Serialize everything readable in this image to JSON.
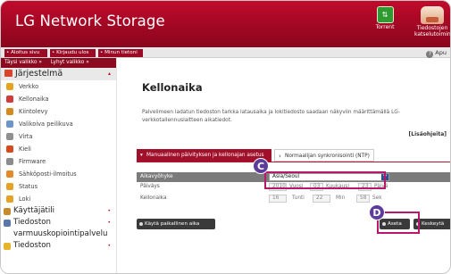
{
  "header": {
    "title": "LG Network Storage",
    "torrent_label": "Torrent",
    "file_service_label_1": "Tiedostojen",
    "file_service_label_2": "katselutoiminta"
  },
  "toolbar": {
    "home": "• Aloitus sivu",
    "logout": "• Kirjaudu ulos",
    "my_data": "• Minun tietoni",
    "help": "Apu"
  },
  "sidebar": {
    "full_menu": "Täysi valikko »",
    "short_menu": "Lyhyt valikko »",
    "category": "Järjestelmä",
    "items": [
      {
        "label": "Verkko",
        "color": "#e4a51d"
      },
      {
        "label": "Kellonaika",
        "color": "#d23b3b"
      },
      {
        "label": "Kiintolevy",
        "color": "#d48b1e"
      },
      {
        "label": "Valikoiva peilikuva",
        "color": "#6d95c9"
      },
      {
        "label": "Virta",
        "color": "#8f8f8f"
      },
      {
        "label": "Kieli",
        "color": "#d64a1d"
      },
      {
        "label": "Firmware",
        "color": "#8c8c8c"
      },
      {
        "label": "Sähköposti-ilmoitus",
        "color": "#e58a2a"
      },
      {
        "label": "Status",
        "color": "#e5a326"
      },
      {
        "label": "Loki",
        "color": "#e5a326"
      }
    ],
    "sub_categories": [
      {
        "label": "Käyttäjätili",
        "color": "#c78a2e"
      },
      {
        "label": "Tiedoston",
        "color": "#5a77a8"
      },
      {
        "label": "varmuuskopiointipalvelu",
        "color": ""
      },
      {
        "label": "Tiedoston",
        "color": "#e5b42a"
      }
    ]
  },
  "main": {
    "title": "Kellonaika",
    "description": "Palvelimeen ladatun tiedoston tarkka latausaika ja lokitiedosto saadaan näkyviin määrittämällä LG-verkkotallennuslaitteen aikatiedot.",
    "more_info": "[Lisäohjeita]",
    "tab_manual": "Manuaalinen päivityksen ja kellonajan asetus",
    "tab_ntp": "Normaalijan synkronisointi (NTP)",
    "timezone_label": "Aikavyöhyke",
    "timezone_value": "Asia/Seoul",
    "date_label": "Päiväys",
    "date_year": "2010",
    "date_year_unit": "Vuosi",
    "date_month": "03",
    "date_month_unit": "Kuukausi",
    "date_day": "23",
    "date_day_unit": "Päivä",
    "time_label": "Kellonaika",
    "time_hour": "16",
    "time_hour_unit": "Tunti",
    "time_min": "22",
    "time_min_unit": "Min",
    "time_sec": "58",
    "time_sec_unit": "Sek",
    "use_local_time": "Käytä paikallinen aika",
    "apply": "Aseta",
    "cancel": "Keskeytä"
  },
  "callouts": {
    "c": "C",
    "d": "D"
  }
}
